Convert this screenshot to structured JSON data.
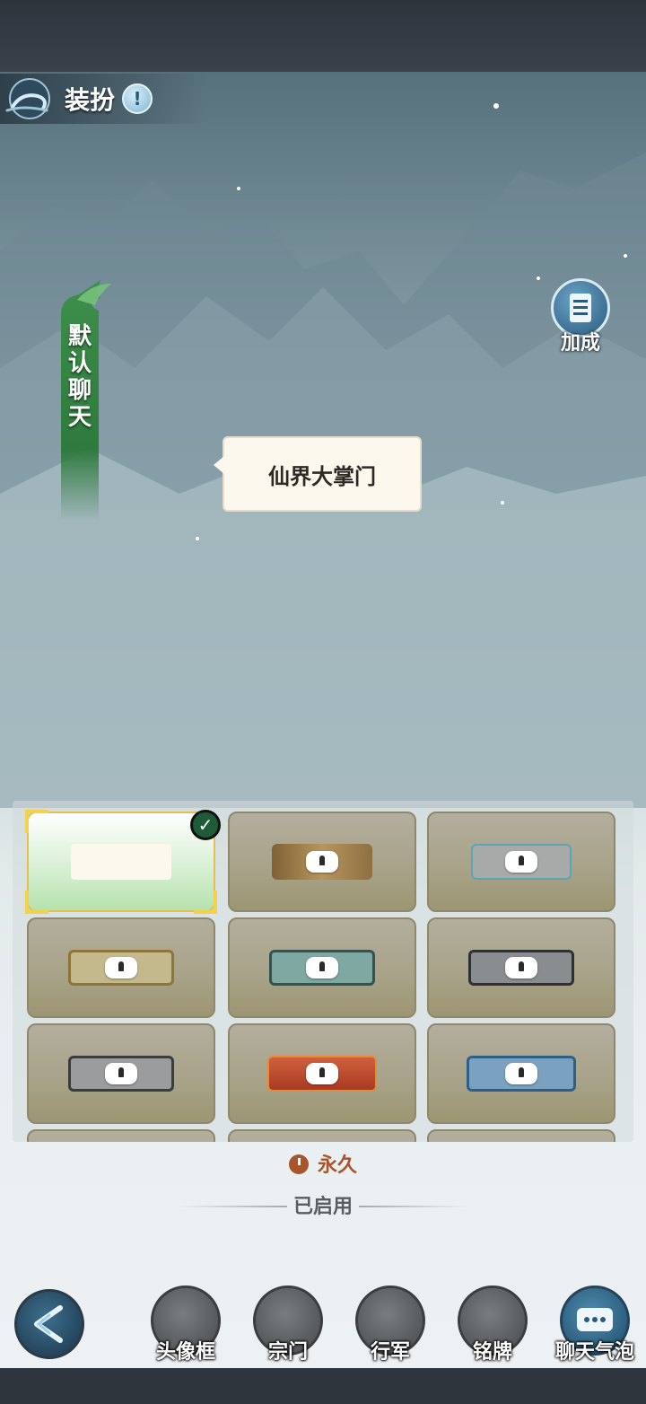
{
  "header": {
    "title": "装扮",
    "info_icon": "!"
  },
  "ribbon": {
    "label": "默认聊天"
  },
  "bonus": {
    "label": "加成"
  },
  "preview": {
    "bubble_text": "仙界大掌门"
  },
  "grid": {
    "tiles": [
      {
        "state": "selected",
        "style": "default-green",
        "equipped": true
      },
      {
        "state": "locked",
        "style": "bronze-brush"
      },
      {
        "state": "locked",
        "style": "teal-vine"
      },
      {
        "state": "locked",
        "style": "gold-ornate"
      },
      {
        "state": "locked",
        "style": "jade-cloud"
      },
      {
        "state": "locked",
        "style": "dark-thorn"
      },
      {
        "state": "locked",
        "style": "silver-rose"
      },
      {
        "state": "locked",
        "style": "flame-red"
      },
      {
        "state": "locked",
        "style": "blue-crystal"
      }
    ]
  },
  "details": {
    "duration": "永久",
    "status": "已启用"
  },
  "nav": {
    "back_icon": "back-arrow-icon",
    "items": [
      {
        "label": "头像框",
        "icon": "avatar-frame-icon"
      },
      {
        "label": "宗门",
        "icon": "sect-gate-icon"
      },
      {
        "label": "行军",
        "icon": "march-flag-icon"
      },
      {
        "label": "铭牌",
        "icon": "nameplate-icon"
      },
      {
        "label": "聊天气泡",
        "icon": "chat-bubble-icon",
        "active": true
      }
    ]
  },
  "colors": {
    "accent": "#a8552c",
    "selected_border": "#e6c04a",
    "ribbon": "#3f8a4c"
  }
}
